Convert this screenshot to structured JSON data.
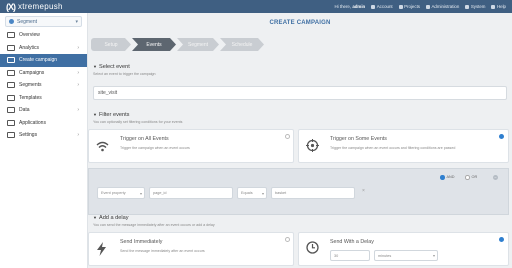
{
  "app": {
    "logo_mark": "(X)",
    "logo_text": "xtremepush"
  },
  "topbar": {
    "greeting_prefix": "Hi there,",
    "user": "admin",
    "links": [
      {
        "label": "Account",
        "icon": "user-icon"
      },
      {
        "label": "Projects",
        "icon": "folder-icon"
      },
      {
        "label": "Administration",
        "icon": "gear-icon"
      },
      {
        "label": "System",
        "icon": "server-icon"
      },
      {
        "label": "Help",
        "icon": "help-icon"
      }
    ]
  },
  "sidebar": {
    "selector": "Segment",
    "items": [
      {
        "label": "Overview",
        "icon": "monitor-icon",
        "chevron": "",
        "active": false
      },
      {
        "label": "Analytics",
        "icon": "chart-icon",
        "chevron": "›",
        "active": false
      },
      {
        "label": "Create campaign",
        "icon": "send-icon",
        "chevron": "",
        "active": true
      },
      {
        "label": "Campaigns",
        "icon": "megaphone-icon",
        "chevron": "›",
        "active": false
      },
      {
        "label": "Segments",
        "icon": "pie-icon",
        "chevron": "›",
        "active": false
      },
      {
        "label": "Templates",
        "icon": "template-icon",
        "chevron": "",
        "active": false
      },
      {
        "label": "Data",
        "icon": "database-icon",
        "chevron": "›",
        "active": false
      },
      {
        "label": "Applications",
        "icon": "apps-icon",
        "chevron": "",
        "active": false
      },
      {
        "label": "Settings",
        "icon": "gear-icon",
        "chevron": "›",
        "active": false
      }
    ]
  },
  "main": {
    "title": "CREATE CAMPAIGN",
    "steps": [
      {
        "label": "Setup",
        "active": false
      },
      {
        "label": "Events",
        "active": true
      },
      {
        "label": "Segment",
        "active": false
      },
      {
        "label": "Schedule",
        "active": false
      }
    ],
    "select_event": {
      "heading": "Select event",
      "sub": "Select an event to trigger the campaign",
      "value": "site_visit"
    },
    "filter_events": {
      "heading": "Filter events",
      "sub": "You can optionally set filtering conditions for your events",
      "options": [
        {
          "title": "Trigger on All Events",
          "desc": "Trigger the campaign when an event occurs",
          "icon": "wifi-icon",
          "selected": false
        },
        {
          "title": "Trigger on Some Events",
          "desc": "Trigger the campaign when an event occurs and filtering conditions are passed",
          "icon": "target-icon",
          "selected": true
        }
      ],
      "logic": {
        "and": "AND",
        "or": "OR",
        "selected": "AND"
      },
      "condition": {
        "property": "Event property",
        "key": "page_id",
        "operator": "Equals",
        "value": "basket"
      }
    },
    "delay": {
      "heading": "Add a delay",
      "sub": "You can send the message immediately after an event occurs or add a delay",
      "options": [
        {
          "title": "Send Immediately",
          "desc": "Send the message immediately after an event occurs",
          "icon": "bolt-icon",
          "selected": false
        },
        {
          "title": "Send With a Delay",
          "desc": "",
          "icon": "clock-icon",
          "selected": true
        }
      ],
      "amount": "30",
      "unit": "minutes"
    }
  },
  "colors": {
    "topbar": "#3f5f82",
    "accent": "#2f7fcf",
    "active_nav": "#3f6fa3"
  }
}
